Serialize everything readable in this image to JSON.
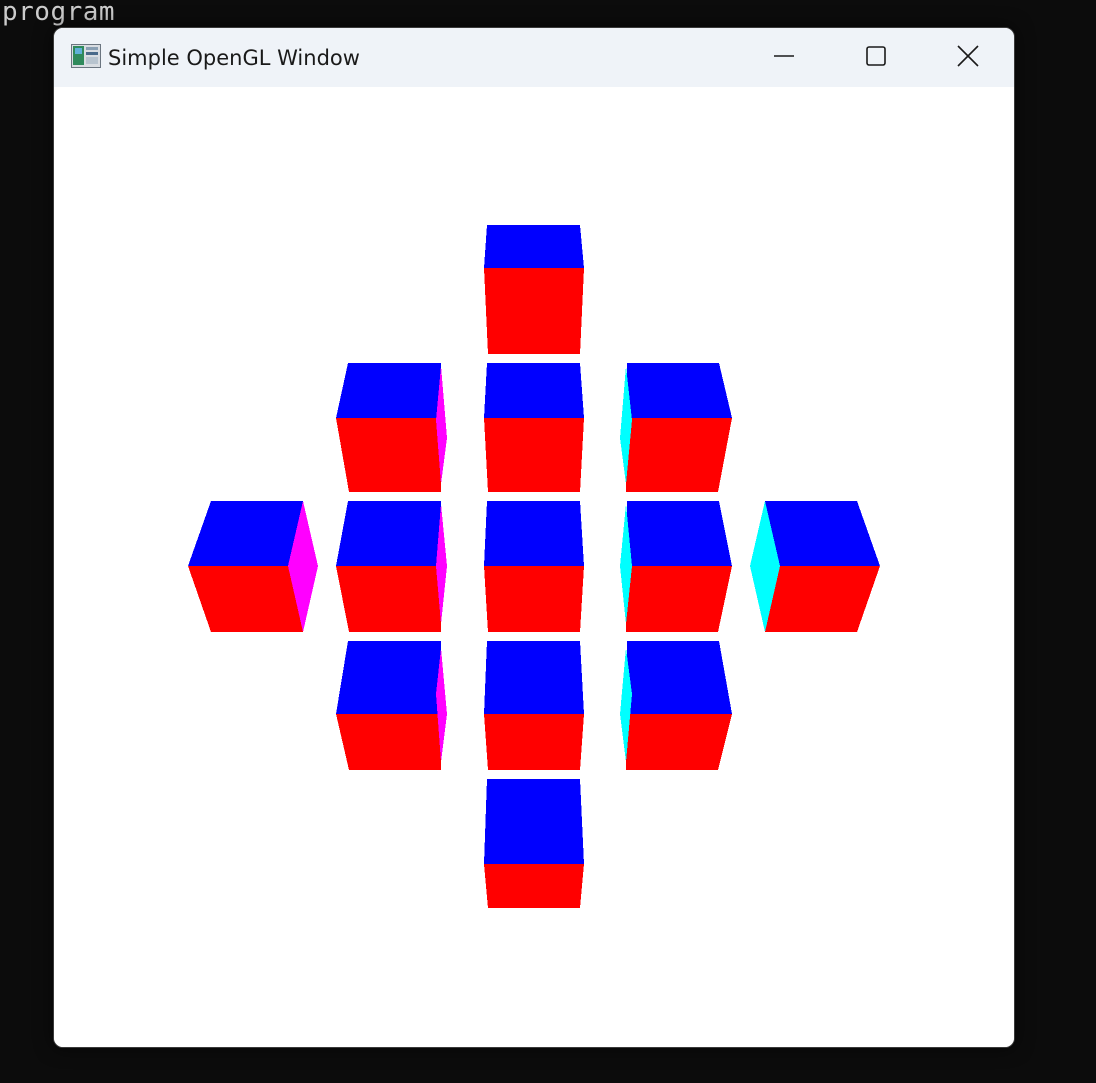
{
  "console": {
    "text": "program"
  },
  "window": {
    "title": "Simple OpenGL Window",
    "app_icon": "opengl-app-icon",
    "controls": {
      "minimize_icon": "minimize-icon",
      "maximize_icon": "maximize-icon",
      "close_icon": "close-icon"
    }
  },
  "scene": {
    "background": "#ffffff",
    "colors": {
      "top_face": "#0000ff",
      "front_face": "#ff0000",
      "left_side_face": "#ff00ff",
      "right_side_face": "#00ffff"
    },
    "cube_count": 13
  }
}
